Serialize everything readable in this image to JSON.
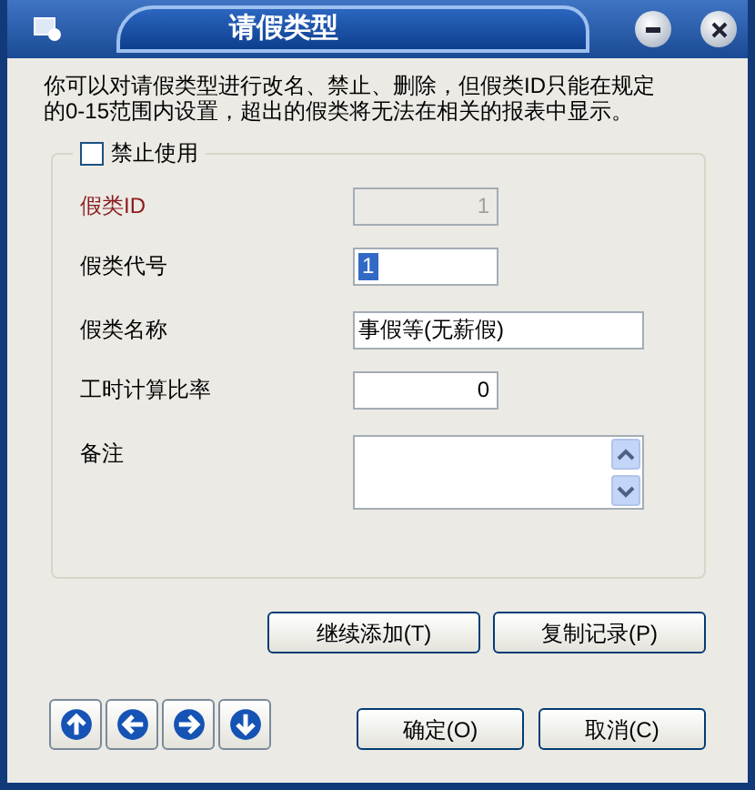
{
  "window": {
    "title": "请假类型"
  },
  "description": "你可以对请假类型进行改名、禁止、删除，但假类ID只能在规定的0-15范围内设置，超出的假类将无法在相关的报表中显示。",
  "disable_checkbox": {
    "label": "禁止使用",
    "checked": false
  },
  "fields": [
    {
      "label": "假类ID",
      "kind": "number",
      "value": "1",
      "disabled": true,
      "required": true
    },
    {
      "label": "假类代号",
      "kind": "code",
      "value": "1",
      "disabled": false,
      "required": false,
      "value_selected": true
    },
    {
      "label": "假类名称",
      "kind": "text",
      "value": "事假等(无薪假)",
      "disabled": false,
      "required": false
    },
    {
      "label": "工时计算比率",
      "kind": "number",
      "value": "0",
      "disabled": false,
      "required": false
    },
    {
      "label": "备注",
      "kind": "memo",
      "disabled": false,
      "required": false
    }
  ],
  "action_buttons": [
    "继续添加(T)",
    "复制记录(P)"
  ],
  "nav_buttons": [
    {
      "kind": "up"
    },
    {
      "kind": "left"
    },
    {
      "kind": "right"
    },
    {
      "kind": "down"
    }
  ],
  "dialog_buttons": [
    "确定(O)",
    "取消(C)"
  ]
}
